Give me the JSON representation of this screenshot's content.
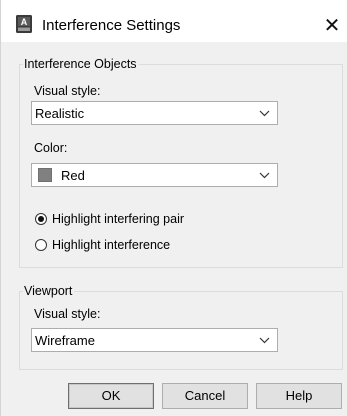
{
  "window": {
    "title": "Interference Settings",
    "close_glyph": "✕",
    "icon": "autocad-app-icon"
  },
  "interference_objects": {
    "legend": "Interference Objects",
    "visual_style_label": "Visual style:",
    "visual_style_value": "Realistic",
    "color_label": "Color:",
    "color_value": "Red",
    "color_swatch": "#808080",
    "radio_pair": "Highlight interfering pair",
    "radio_interference": "Highlight interference",
    "selected_radio": "Highlight interfering pair"
  },
  "viewport": {
    "legend": "Viewport",
    "visual_style_label": "Visual style:",
    "visual_style_value": "Wireframe"
  },
  "buttons": {
    "ok": "OK",
    "cancel": "Cancel",
    "help": "Help"
  }
}
